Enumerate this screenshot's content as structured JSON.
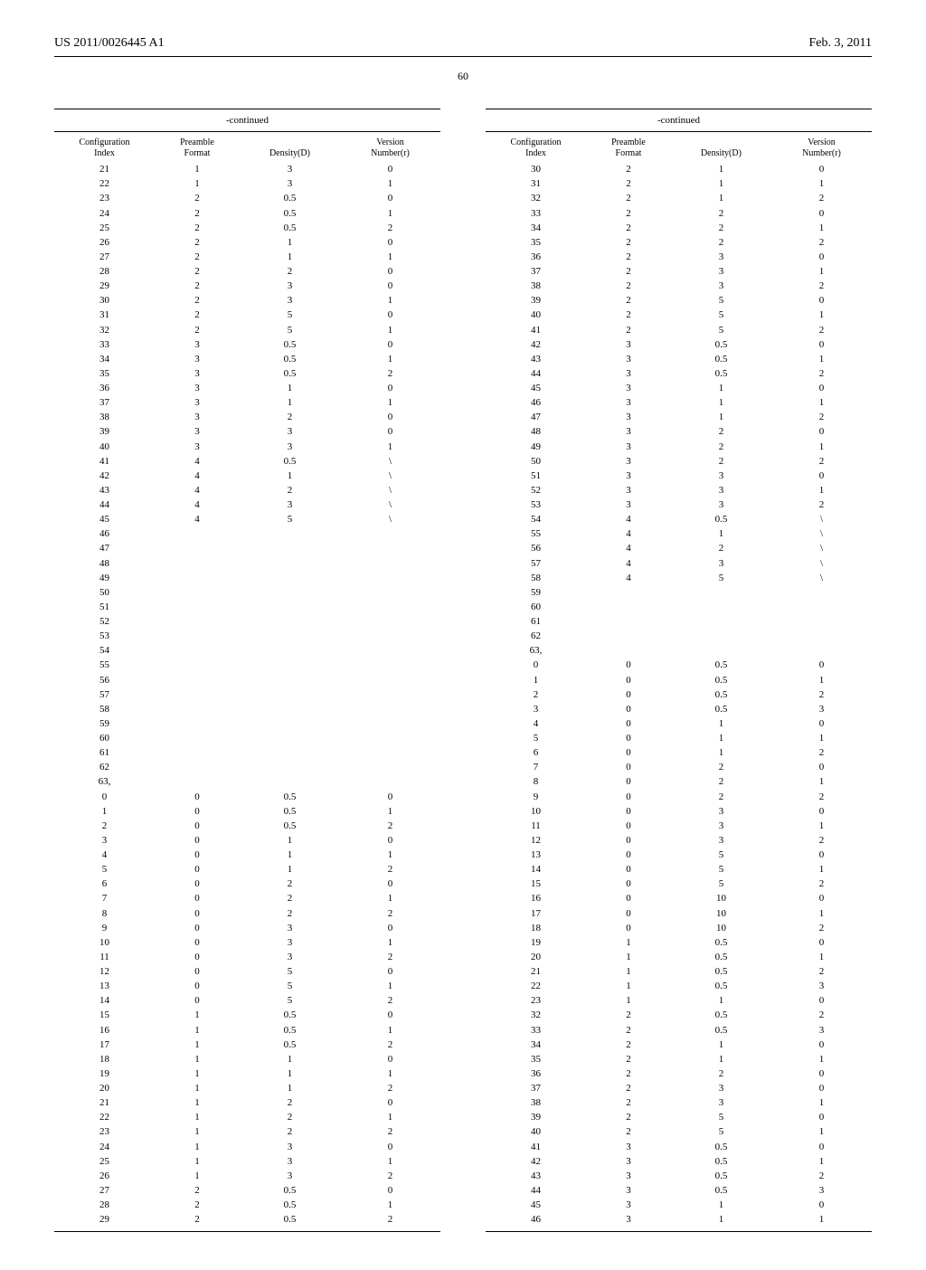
{
  "header": {
    "left": "US 2011/0026445 A1",
    "right": "Feb. 3, 2011",
    "page_number": "60"
  },
  "table_meta": {
    "caption": "-continued",
    "columns": [
      {
        "l1": "Configuration",
        "l2": "Index"
      },
      {
        "l1": "Preamble",
        "l2": "Format"
      },
      {
        "l1": "",
        "l2": "Density(D)"
      },
      {
        "l1": "Version",
        "l2": "Number(r)"
      }
    ]
  },
  "left_rows": [
    [
      "21",
      "1",
      "3",
      "0"
    ],
    [
      "22",
      "1",
      "3",
      "1"
    ],
    [
      "23",
      "2",
      "0.5",
      "0"
    ],
    [
      "24",
      "2",
      "0.5",
      "1"
    ],
    [
      "25",
      "2",
      "0.5",
      "2"
    ],
    [
      "26",
      "2",
      "1",
      "0"
    ],
    [
      "27",
      "2",
      "1",
      "1"
    ],
    [
      "28",
      "2",
      "2",
      "0"
    ],
    [
      "29",
      "2",
      "3",
      "0"
    ],
    [
      "30",
      "2",
      "3",
      "1"
    ],
    [
      "31",
      "2",
      "5",
      "0"
    ],
    [
      "32",
      "2",
      "5",
      "1"
    ],
    [
      "33",
      "3",
      "0.5",
      "0"
    ],
    [
      "34",
      "3",
      "0.5",
      "1"
    ],
    [
      "35",
      "3",
      "0.5",
      "2"
    ],
    [
      "36",
      "3",
      "1",
      "0"
    ],
    [
      "37",
      "3",
      "1",
      "1"
    ],
    [
      "38",
      "3",
      "2",
      "0"
    ],
    [
      "39",
      "3",
      "3",
      "0"
    ],
    [
      "40",
      "3",
      "3",
      "1"
    ],
    [
      "41",
      "4",
      "0.5",
      "\\"
    ],
    [
      "42",
      "4",
      "1",
      "\\"
    ],
    [
      "43",
      "4",
      "2",
      "\\"
    ],
    [
      "44",
      "4",
      "3",
      "\\"
    ],
    [
      "45",
      "4",
      "5",
      "\\"
    ],
    [
      "46",
      "",
      "",
      ""
    ],
    [
      "47",
      "",
      "",
      ""
    ],
    [
      "48",
      "",
      "",
      ""
    ],
    [
      "49",
      "",
      "",
      ""
    ],
    [
      "50",
      "",
      "",
      ""
    ],
    [
      "51",
      "",
      "",
      ""
    ],
    [
      "52",
      "",
      "",
      ""
    ],
    [
      "53",
      "",
      "",
      ""
    ],
    [
      "54",
      "",
      "",
      ""
    ],
    [
      "55",
      "",
      "",
      ""
    ],
    [
      "56",
      "",
      "",
      ""
    ],
    [
      "57",
      "",
      "",
      ""
    ],
    [
      "58",
      "",
      "",
      ""
    ],
    [
      "59",
      "",
      "",
      ""
    ],
    [
      "60",
      "",
      "",
      ""
    ],
    [
      "61",
      "",
      "",
      ""
    ],
    [
      "62",
      "",
      "",
      ""
    ],
    [
      "63,",
      "",
      "",
      ""
    ],
    [
      "0",
      "0",
      "0.5",
      "0"
    ],
    [
      "1",
      "0",
      "0.5",
      "1"
    ],
    [
      "2",
      "0",
      "0.5",
      "2"
    ],
    [
      "3",
      "0",
      "1",
      "0"
    ],
    [
      "4",
      "0",
      "1",
      "1"
    ],
    [
      "5",
      "0",
      "1",
      "2"
    ],
    [
      "6",
      "0",
      "2",
      "0"
    ],
    [
      "7",
      "0",
      "2",
      "1"
    ],
    [
      "8",
      "0",
      "2",
      "2"
    ],
    [
      "9",
      "0",
      "3",
      "0"
    ],
    [
      "10",
      "0",
      "3",
      "1"
    ],
    [
      "11",
      "0",
      "3",
      "2"
    ],
    [
      "12",
      "0",
      "5",
      "0"
    ],
    [
      "13",
      "0",
      "5",
      "1"
    ],
    [
      "14",
      "0",
      "5",
      "2"
    ],
    [
      "15",
      "1",
      "0.5",
      "0"
    ],
    [
      "16",
      "1",
      "0.5",
      "1"
    ],
    [
      "17",
      "1",
      "0.5",
      "2"
    ],
    [
      "18",
      "1",
      "1",
      "0"
    ],
    [
      "19",
      "1",
      "1",
      "1"
    ],
    [
      "20",
      "1",
      "1",
      "2"
    ],
    [
      "21",
      "1",
      "2",
      "0"
    ],
    [
      "22",
      "1",
      "2",
      "1"
    ],
    [
      "23",
      "1",
      "2",
      "2"
    ],
    [
      "24",
      "1",
      "3",
      "0"
    ],
    [
      "25",
      "1",
      "3",
      "1"
    ],
    [
      "26",
      "1",
      "3",
      "2"
    ],
    [
      "27",
      "2",
      "0.5",
      "0"
    ],
    [
      "28",
      "2",
      "0.5",
      "1"
    ],
    [
      "29",
      "2",
      "0.5",
      "2"
    ]
  ],
  "right_rows": [
    [
      "30",
      "2",
      "1",
      "0"
    ],
    [
      "31",
      "2",
      "1",
      "1"
    ],
    [
      "32",
      "2",
      "1",
      "2"
    ],
    [
      "33",
      "2",
      "2",
      "0"
    ],
    [
      "34",
      "2",
      "2",
      "1"
    ],
    [
      "35",
      "2",
      "2",
      "2"
    ],
    [
      "36",
      "2",
      "3",
      "0"
    ],
    [
      "37",
      "2",
      "3",
      "1"
    ],
    [
      "38",
      "2",
      "3",
      "2"
    ],
    [
      "39",
      "2",
      "5",
      "0"
    ],
    [
      "40",
      "2",
      "5",
      "1"
    ],
    [
      "41",
      "2",
      "5",
      "2"
    ],
    [
      "42",
      "3",
      "0.5",
      "0"
    ],
    [
      "43",
      "3",
      "0.5",
      "1"
    ],
    [
      "44",
      "3",
      "0.5",
      "2"
    ],
    [
      "45",
      "3",
      "1",
      "0"
    ],
    [
      "46",
      "3",
      "1",
      "1"
    ],
    [
      "47",
      "3",
      "1",
      "2"
    ],
    [
      "48",
      "3",
      "2",
      "0"
    ],
    [
      "49",
      "3",
      "2",
      "1"
    ],
    [
      "50",
      "3",
      "2",
      "2"
    ],
    [
      "51",
      "3",
      "3",
      "0"
    ],
    [
      "52",
      "3",
      "3",
      "1"
    ],
    [
      "53",
      "3",
      "3",
      "2"
    ],
    [
      "54",
      "4",
      "0.5",
      "\\"
    ],
    [
      "55",
      "4",
      "1",
      "\\"
    ],
    [
      "56",
      "4",
      "2",
      "\\"
    ],
    [
      "57",
      "4",
      "3",
      "\\"
    ],
    [
      "58",
      "4",
      "5",
      "\\"
    ],
    [
      "59",
      "",
      "",
      ""
    ],
    [
      "60",
      "",
      "",
      ""
    ],
    [
      "61",
      "",
      "",
      ""
    ],
    [
      "62",
      "",
      "",
      ""
    ],
    [
      "63,",
      "",
      "",
      ""
    ],
    [
      "0",
      "0",
      "0.5",
      "0"
    ],
    [
      "1",
      "0",
      "0.5",
      "1"
    ],
    [
      "2",
      "0",
      "0.5",
      "2"
    ],
    [
      "3",
      "0",
      "0.5",
      "3"
    ],
    [
      "4",
      "0",
      "1",
      "0"
    ],
    [
      "5",
      "0",
      "1",
      "1"
    ],
    [
      "6",
      "0",
      "1",
      "2"
    ],
    [
      "7",
      "0",
      "2",
      "0"
    ],
    [
      "8",
      "0",
      "2",
      "1"
    ],
    [
      "9",
      "0",
      "2",
      "2"
    ],
    [
      "10",
      "0",
      "3",
      "0"
    ],
    [
      "11",
      "0",
      "3",
      "1"
    ],
    [
      "12",
      "0",
      "3",
      "2"
    ],
    [
      "13",
      "0",
      "5",
      "0"
    ],
    [
      "14",
      "0",
      "5",
      "1"
    ],
    [
      "15",
      "0",
      "5",
      "2"
    ],
    [
      "16",
      "0",
      "10",
      "0"
    ],
    [
      "17",
      "0",
      "10",
      "1"
    ],
    [
      "18",
      "0",
      "10",
      "2"
    ],
    [
      "19",
      "1",
      "0.5",
      "0"
    ],
    [
      "20",
      "1",
      "0.5",
      "1"
    ],
    [
      "21",
      "1",
      "0.5",
      "2"
    ],
    [
      "22",
      "1",
      "0.5",
      "3"
    ],
    [
      "23",
      "1",
      "1",
      "0"
    ],
    [
      "32",
      "2",
      "0.5",
      "2"
    ],
    [
      "33",
      "2",
      "0.5",
      "3"
    ],
    [
      "34",
      "2",
      "1",
      "0"
    ],
    [
      "35",
      "2",
      "1",
      "1"
    ],
    [
      "36",
      "2",
      "2",
      "0"
    ],
    [
      "37",
      "2",
      "3",
      "0"
    ],
    [
      "38",
      "2",
      "3",
      "1"
    ],
    [
      "39",
      "2",
      "5",
      "0"
    ],
    [
      "40",
      "2",
      "5",
      "1"
    ],
    [
      "41",
      "3",
      "0.5",
      "0"
    ],
    [
      "42",
      "3",
      "0.5",
      "1"
    ],
    [
      "43",
      "3",
      "0.5",
      "2"
    ],
    [
      "44",
      "3",
      "0.5",
      "3"
    ],
    [
      "45",
      "3",
      "1",
      "0"
    ],
    [
      "46",
      "3",
      "1",
      "1"
    ]
  ]
}
